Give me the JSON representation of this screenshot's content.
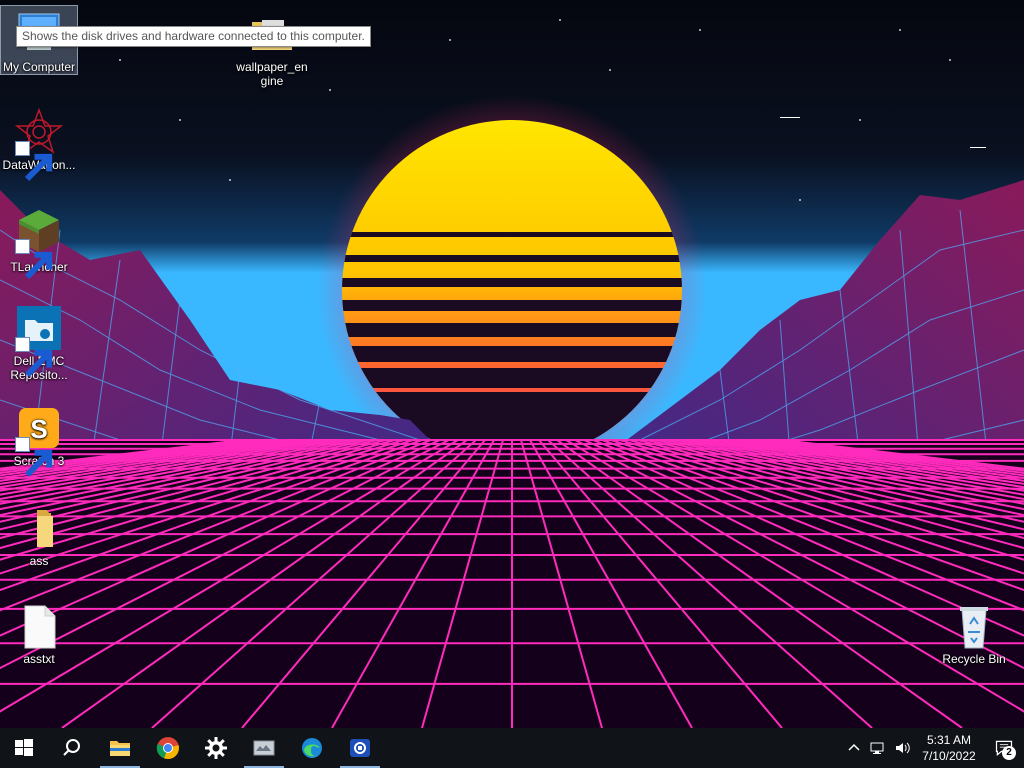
{
  "desktop": {
    "tooltip": "Shows the disk drives and hardware connected to this computer.",
    "icons": [
      {
        "label": "My Computer",
        "icon": "computer-icon"
      },
      {
        "label": "wallpaper_en\ngine",
        "icon": "folder-icon"
      },
      {
        "label": "DataWagon...",
        "icon": "datawagon-icon"
      },
      {
        "label": "TLauncher",
        "icon": "minecraft-block-icon"
      },
      {
        "label": "Dell EMC\nReposito...",
        "icon": "dell-emc-folder-icon"
      },
      {
        "label": "Scratch 3",
        "icon": "scratch-icon"
      },
      {
        "label": "ass",
        "icon": "folder-icon"
      },
      {
        "label": "asstxt",
        "icon": "text-file-icon"
      },
      {
        "label": "Recycle Bin",
        "icon": "recycle-bin-icon"
      }
    ]
  },
  "taskbar": {
    "apps": [
      "start-icon",
      "search-icon",
      "file-explorer-icon",
      "chrome-icon",
      "settings-icon",
      "app-icon",
      "edge-icon",
      "remote-app-icon"
    ],
    "clock": {
      "time": "5:31 AM",
      "date": "7/10/2022"
    },
    "notification_count": "2"
  },
  "colors": {
    "taskbar": "#101318",
    "sun_top": "#ffe600",
    "sun_bottom": "#ff2a6d",
    "grid": "#ff2bbd",
    "horizon": "#3ab8ff"
  }
}
